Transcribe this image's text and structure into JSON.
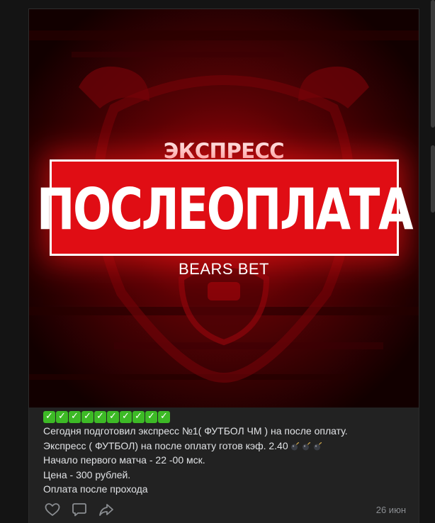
{
  "post": {
    "image": {
      "kicker": "ЭКСПРЕСС",
      "headline": "ПОСЛЕОПЛАТА",
      "brand": "BEARS BET"
    },
    "check_emoji_count": 10,
    "lines": [
      "Сегодня подготовил экспресс №1( ФУТБОЛ ЧМ ) на после оплату.",
      "Экспресс ( ФУТБОЛ) на после оплату готов кэф. 2.40",
      "Начало первого матча - 22 -00 мск.",
      "Цена - 300 рублей.",
      "Оплата после прохода"
    ],
    "bomb_emoji_count": 3,
    "date": "26 июн"
  },
  "icons": {
    "like": "heart-icon",
    "comment": "comment-icon",
    "share": "share-icon",
    "check": "check-mark-emoji",
    "bomb": "bomb-emoji"
  },
  "colors": {
    "background": "#141414",
    "card": "#222222",
    "text": "#e1e3e6",
    "muted": "#8a8d91",
    "accent_red": "#e00d14",
    "check_green": "#3dba26"
  }
}
